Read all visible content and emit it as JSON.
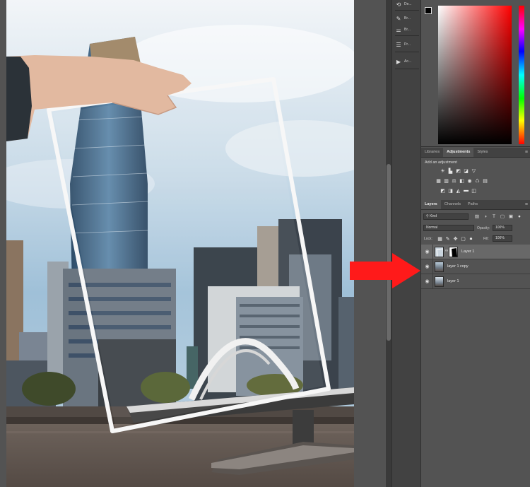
{
  "strip_items": [
    {
      "icon": "history-icon",
      "label": "De..."
    },
    {
      "icon": "brush-icon",
      "label": "Br..."
    },
    {
      "icon": "brush-settings-icon",
      "label": "Br..."
    },
    {
      "icon": "properties-icon",
      "label": "Pr..."
    },
    {
      "icon": "actions-icon",
      "label": "Ac..."
    }
  ],
  "tabs_mid": {
    "libraries": "Libraries",
    "adjustments": "Adjustments",
    "styles": "Styles"
  },
  "adjustments": {
    "title": "Add an adjustment"
  },
  "tabs_layers": {
    "layers": "Layers",
    "channels": "Channels",
    "paths": "Paths"
  },
  "layers_panel": {
    "filter_kind": "Kind",
    "blend_mode": "Normal",
    "opacity_label": "Opacity:",
    "opacity_value": "100%",
    "lock_label": "Lock:",
    "fill_label": "Fill:",
    "fill_value": "100%"
  },
  "layers": [
    {
      "name": "Layer 1",
      "selected": true,
      "has_mask": true
    },
    {
      "name": "layer 1 copy",
      "selected": false,
      "has_mask": false
    },
    {
      "name": "layer 1",
      "selected": false,
      "has_mask": false
    }
  ],
  "colors": {
    "accent_arrow": "#ff1a1a",
    "panel_bg": "#535353",
    "panel_dark": "#424242"
  }
}
